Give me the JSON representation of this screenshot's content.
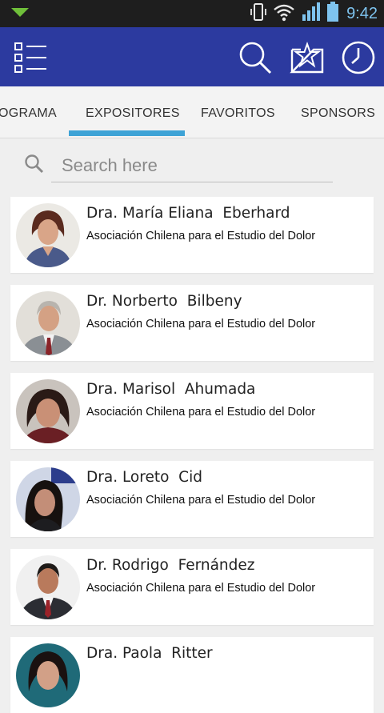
{
  "status_bar": {
    "time": "9:42",
    "icons": [
      "notification-icon",
      "vibrate-icon",
      "wifi-icon",
      "signal-icon",
      "battery-icon"
    ]
  },
  "app_bar": {
    "background": "#2c3a9f",
    "icons": [
      "menu-list-icon",
      "search-icon",
      "favorite-star-icon",
      "clock-icon"
    ]
  },
  "tabs": {
    "items": [
      {
        "label": "OGRAMA",
        "selected": false
      },
      {
        "label": "EXPOSITORES",
        "selected": true
      },
      {
        "label": "FAVORITOS",
        "selected": false
      },
      {
        "label": "SPONSORS",
        "selected": false
      }
    ],
    "indicator_color": "#3ea3d6"
  },
  "search": {
    "placeholder": "Search here",
    "value": ""
  },
  "speakers": [
    {
      "name": "Dra. María Eliana  Eberhard",
      "org": "Asociación Chilena para el Estudio del Dolor"
    },
    {
      "name": "Dr. Norberto  Bilbeny",
      "org": "Asociación Chilena para el Estudio del Dolor"
    },
    {
      "name": "Dra. Marisol  Ahumada",
      "org": "Asociación Chilena para el Estudio del Dolor"
    },
    {
      "name": "Dra. Loreto  Cid",
      "org": "Asociación Chilena para el Estudio del Dolor"
    },
    {
      "name": "Dr. Rodrigo  Fernández",
      "org": "Asociación Chilena para el Estudio del Dolor"
    },
    {
      "name": "Dra. Paola  Ritter",
      "org": ""
    }
  ]
}
